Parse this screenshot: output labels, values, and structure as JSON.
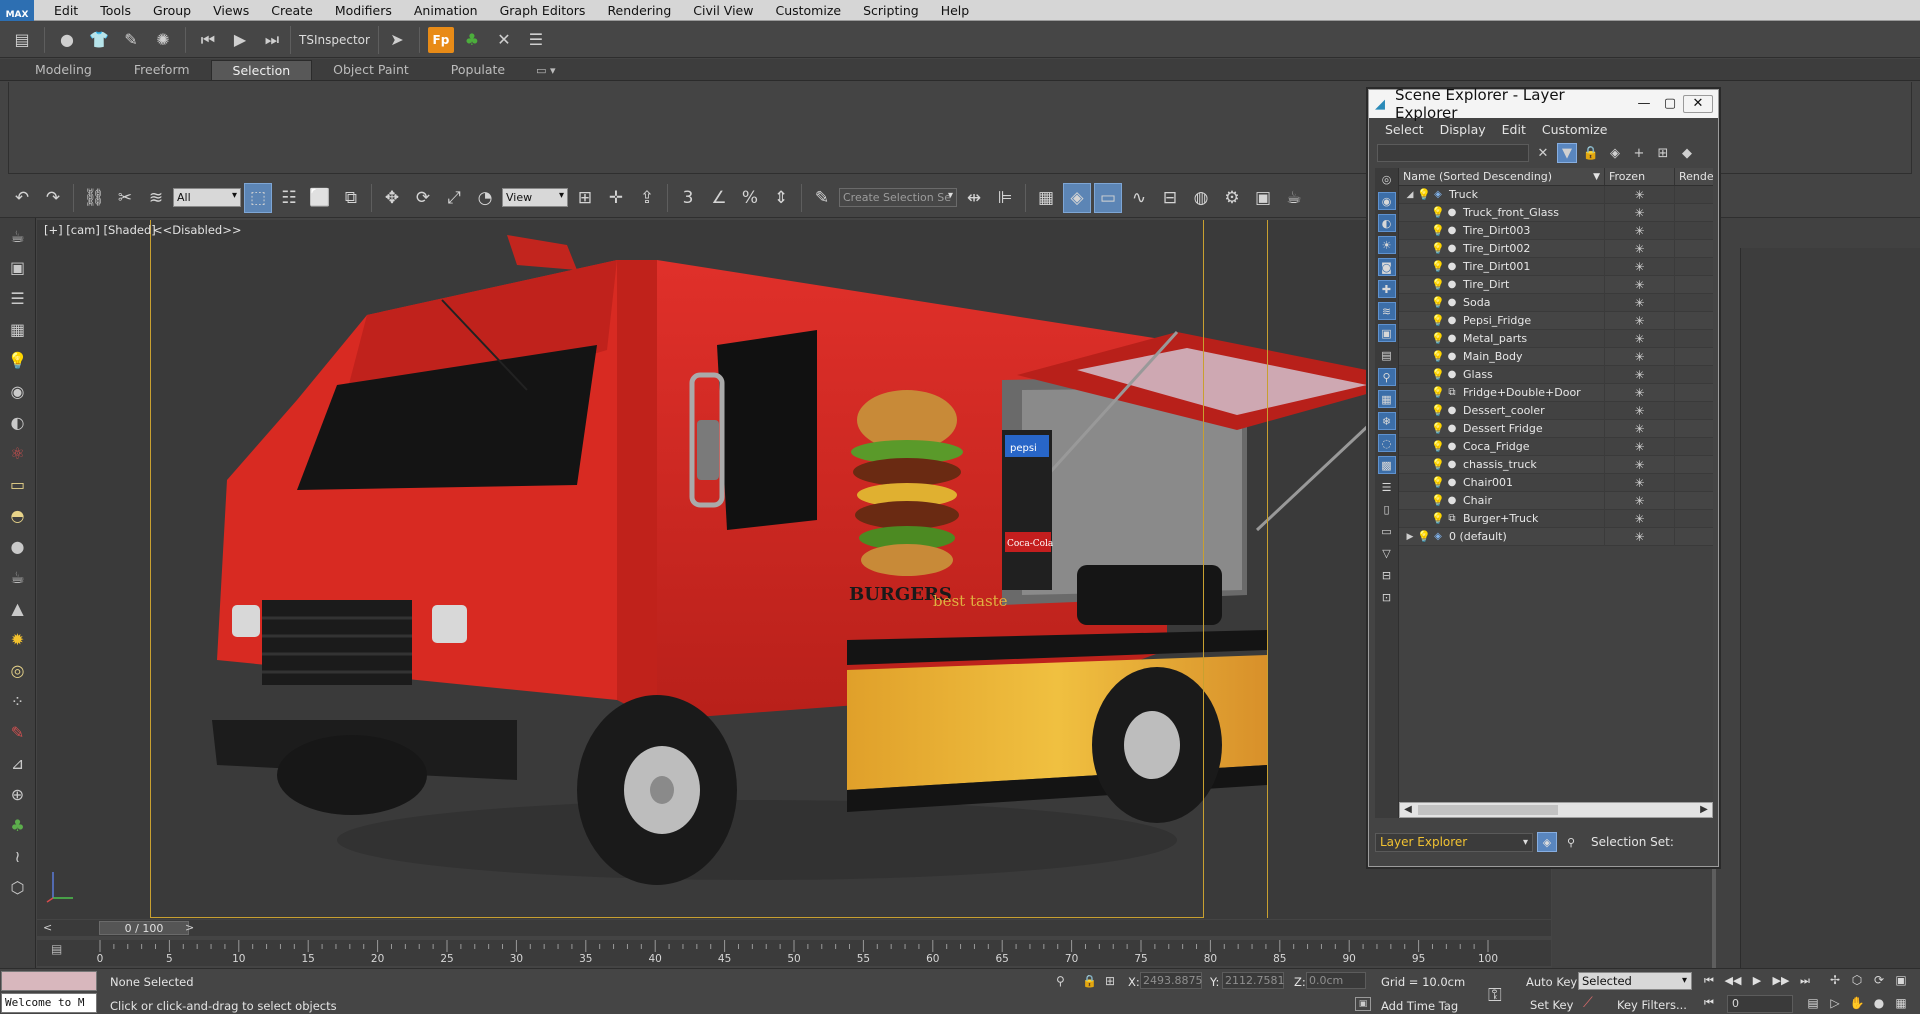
{
  "menubar": {
    "logo": "MAX",
    "items": [
      "Edit",
      "Tools",
      "Group",
      "Views",
      "Create",
      "Modifiers",
      "Animation",
      "Graph Editors",
      "Rendering",
      "Civil View",
      "Customize",
      "Scripting",
      "Help"
    ]
  },
  "maintoolbar": {
    "tsinspector_label": "TSInspector",
    "fp_label": "Fp"
  },
  "ribbon": {
    "tabs": [
      "Modeling",
      "Freeform",
      "Selection",
      "Object Paint",
      "Populate"
    ],
    "active_tab": "Selection",
    "extra": "▭ ▾"
  },
  "toolbar2": {
    "filter_value": "All",
    "refcoord_value": "View",
    "selection_set_placeholder": "Create Selection Se",
    "snap_label": "3"
  },
  "viewport": {
    "label": "[+] [cam] [Shaded]",
    "disabled_label": "<<Disabled>>",
    "truck_text_burgers": "BURGERS",
    "truck_text_besttaste": "best taste",
    "truck_text_pepsi": "pepsi",
    "truck_text_cola": "Coca-Cola"
  },
  "scene_explorer": {
    "title": "Scene Explorer - Layer Explorer",
    "menu": [
      "Select",
      "Display",
      "Edit",
      "Customize"
    ],
    "columns": {
      "name": "Name (Sorted Descending)",
      "frozen": "Frozen",
      "render": "Rende"
    },
    "rows": [
      {
        "name": "Truck",
        "level": 0,
        "kind": "layer",
        "expander": "◢"
      },
      {
        "name": "Truck_front_Glass",
        "level": 1,
        "kind": "object"
      },
      {
        "name": "Tire_Dirt003",
        "level": 1,
        "kind": "object"
      },
      {
        "name": "Tire_Dirt002",
        "level": 1,
        "kind": "object"
      },
      {
        "name": "Tire_Dirt001",
        "level": 1,
        "kind": "object"
      },
      {
        "name": "Tire_Dirt",
        "level": 1,
        "kind": "object"
      },
      {
        "name": "Soda",
        "level": 1,
        "kind": "object"
      },
      {
        "name": "Pepsi_Fridge",
        "level": 1,
        "kind": "object"
      },
      {
        "name": "Metal_parts",
        "level": 1,
        "kind": "object"
      },
      {
        "name": "Main_Body",
        "level": 1,
        "kind": "object"
      },
      {
        "name": "Glass",
        "level": 1,
        "kind": "object"
      },
      {
        "name": "Fridge+Double+Door",
        "level": 1,
        "kind": "group"
      },
      {
        "name": "Dessert_cooler",
        "level": 1,
        "kind": "object"
      },
      {
        "name": "Dessert Fridge",
        "level": 1,
        "kind": "object"
      },
      {
        "name": "Coca_Fridge",
        "level": 1,
        "kind": "object"
      },
      {
        "name": "chassis_truck",
        "level": 1,
        "kind": "object"
      },
      {
        "name": "Chair001",
        "level": 1,
        "kind": "object"
      },
      {
        "name": "Chair",
        "level": 1,
        "kind": "object"
      },
      {
        "name": "Burger+Truck",
        "level": 1,
        "kind": "group"
      },
      {
        "name": "0 (default)",
        "level": 0,
        "kind": "layer",
        "expander": "▶"
      }
    ],
    "footer": {
      "explorer_select": "Layer Explorer",
      "selection_set_label": "Selection Set:"
    }
  },
  "timeline": {
    "frame_label": "0 / 100",
    "left_arrow": "<",
    "right_arrow": ">",
    "ticks": [
      "0",
      "5",
      "10",
      "15",
      "20",
      "25",
      "30",
      "35",
      "40",
      "45",
      "50",
      "55",
      "60",
      "65",
      "70",
      "75",
      "80",
      "85",
      "90",
      "95",
      "100"
    ]
  },
  "statusbar": {
    "listener_text": "Welcome to M",
    "status_primary": "None Selected",
    "status_prompt": "Click or click-and-drag to select objects",
    "x_label": "X:",
    "x_value": "2493.8875",
    "y_label": "Y:",
    "y_value": "2112.7581",
    "z_label": "Z:",
    "z_value": "0.0cm",
    "grid": "Grid = 10.0cm",
    "add_time_tag": "Add Time Tag",
    "auto_key": "Auto Key",
    "set_key": "Set Key",
    "selected_dd": "Selected",
    "key_filters": "Key Filters...",
    "frame_input": "0"
  },
  "colors": {
    "accent_blue": "#5c85b5",
    "truck_red": "#d2231c",
    "safe_frame": "#c8a030",
    "layer_explorer_text": "#f1c232"
  }
}
